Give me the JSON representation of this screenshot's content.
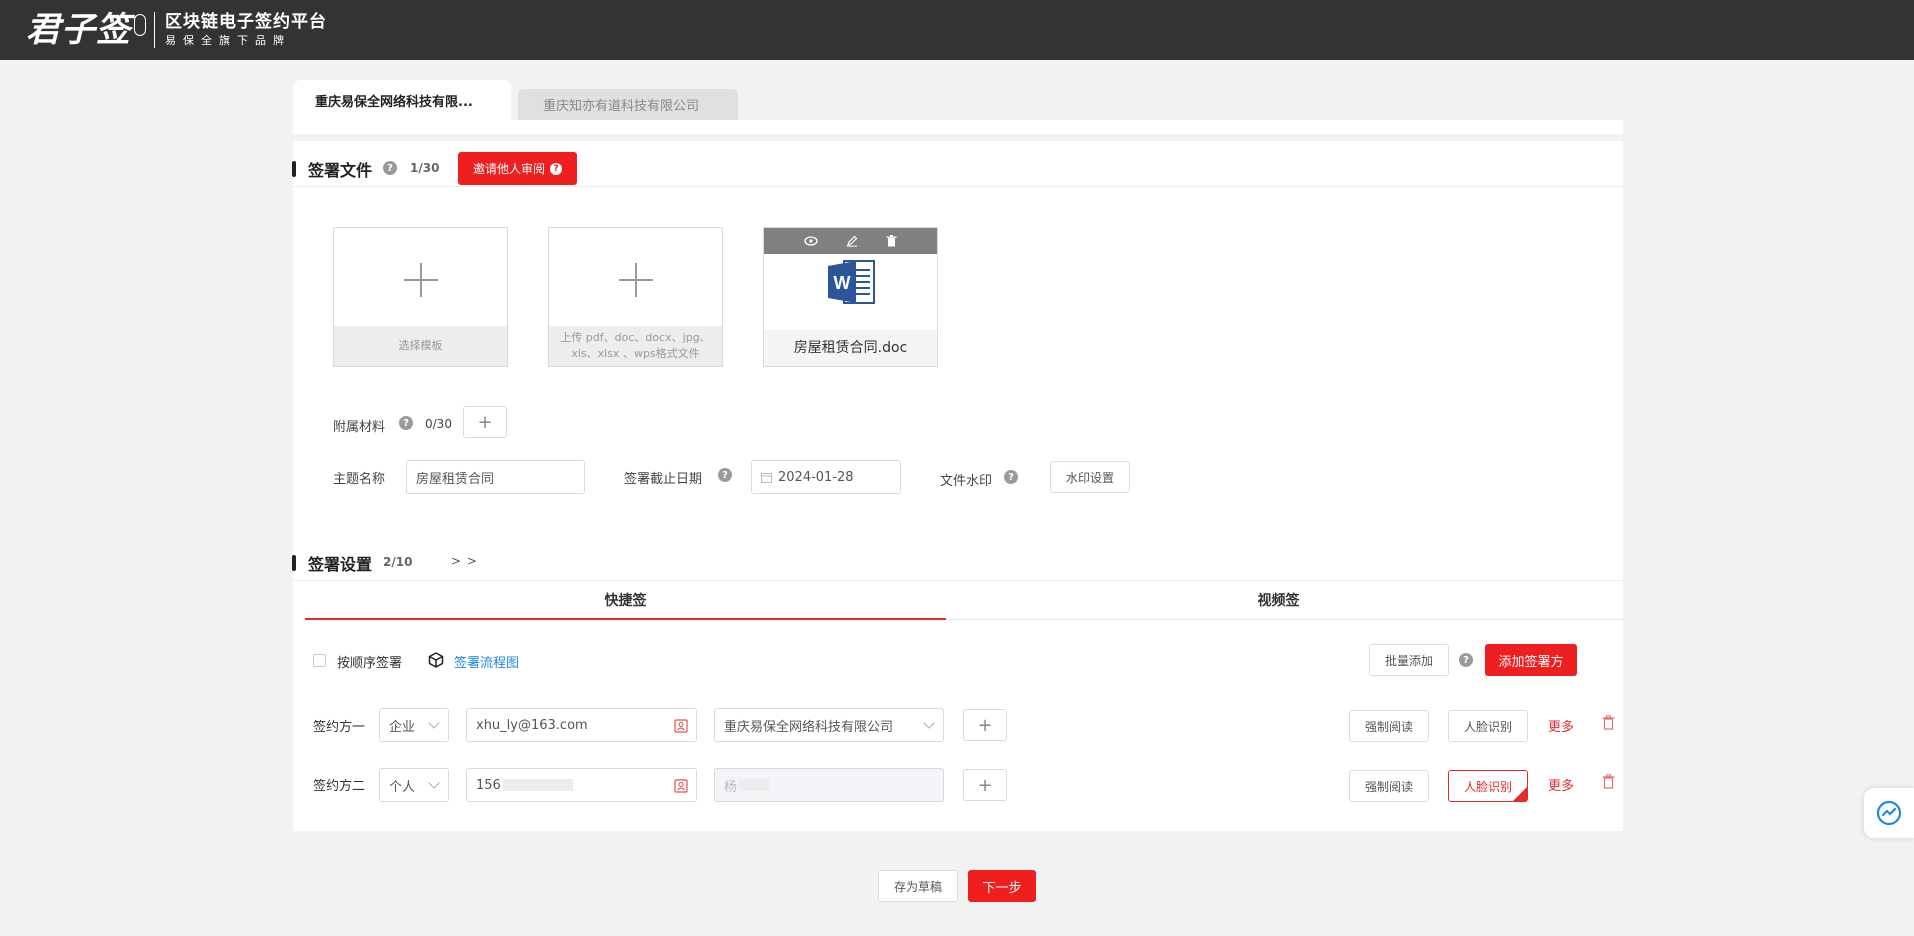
{
  "header": {
    "logo_text": "君子签",
    "title": "区块链电子签约平台",
    "subtitle": "易保全旗下品牌"
  },
  "company_tabs": [
    {
      "label": "重庆易保全网络科技有限...",
      "active": true
    },
    {
      "label": "重庆知亦有道科技有限公司",
      "active": false
    }
  ],
  "sign_files": {
    "title": "签署文件",
    "count": "1/30",
    "invite_button": "邀请他人审阅",
    "cards": {
      "template": "选择模板",
      "upload": "上传 pdf、doc、docx、jpg、xls、xlsx 、wps格式文件",
      "document_name": "房屋租赁合同.doc"
    },
    "attachments": {
      "label": "附属材料",
      "count": "0/30"
    },
    "subject": {
      "label": "主题名称",
      "value": "房屋租赁合同"
    },
    "deadline": {
      "label": "签署截止日期",
      "value": "2024-01-28"
    },
    "watermark": {
      "label": "文件水印",
      "button": "水印设置"
    }
  },
  "sign_settings": {
    "title": "签署设置",
    "count": "2/10",
    "expand": "> >",
    "tabs": [
      "快捷签",
      "视频签"
    ],
    "sequential_label": "按顺序签署",
    "flow_link": "签署流程图",
    "batch_add": "批量添加",
    "add_signer": "添加签署方",
    "signers": [
      {
        "label": "签约方一",
        "type": "企业",
        "account": "xhu_ly@163.com",
        "name": "重庆易保全网络科技有限公司",
        "force_read": "强制阅读",
        "face": "人脸识别",
        "more": "更多"
      },
      {
        "label": "签约方二",
        "type": "个人",
        "account": "156",
        "name": "杨",
        "force_read": "强制阅读",
        "face": "人脸识别",
        "more": "更多"
      }
    ]
  },
  "footer": {
    "save_draft": "存为草稿",
    "next": "下一步"
  },
  "colors": {
    "accent": "#f01f1f",
    "header_bg": "#333333",
    "link": "#1e88e5"
  }
}
